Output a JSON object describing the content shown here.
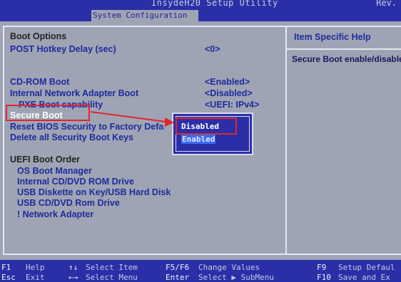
{
  "header": {
    "app_title": "InsydeH20 Setup Utility",
    "rev": "Rev.",
    "active_tab": "System Configuration"
  },
  "settings": {
    "boot_options_heading": "Boot Options",
    "post_delay_label": "POST Hotkey Delay (sec)",
    "post_delay_value": "<0>",
    "cdrom_label": "CD-ROM Boot",
    "cdrom_value": "<Enabled>",
    "nic_label": "Internal Network Adapter Boot",
    "nic_value": "<Disabled>",
    "pxe_label": "PXE Boot capability",
    "pxe_value": "<UEFI: IPv4>",
    "secure_boot_label": "Secure Boot",
    "reset_bios_label": "Reset BIOS Security to Factory Defa",
    "delete_keys_label": "Delete all Security Boot Keys",
    "uefi_heading": "UEFI Boot Order",
    "boot_order": [
      "OS Boot Manager",
      "Internal CD/DVD ROM Drive",
      "USB Diskette on Key/USB Hard Disk",
      "USB CD/DVD Rom Drive",
      "! Network Adapter"
    ]
  },
  "popup": {
    "options": [
      "Disabled",
      "Enabled"
    ],
    "selected": "Enabled"
  },
  "help": {
    "title": "Item Specific Help",
    "text": "Secure Boot enable/disable"
  },
  "footer": {
    "keys": [
      {
        "key": "F1",
        "desc": "Help"
      },
      {
        "key": "Esc",
        "desc": "Exit"
      },
      {
        "key": "↑↓",
        "desc": "Select Item"
      },
      {
        "key": "←→",
        "desc": "Select Menu"
      },
      {
        "key": "F5/F6",
        "desc": "Change Values"
      },
      {
        "key": "Enter",
        "desc": "Select ▶ SubMenu"
      },
      {
        "key": "F9",
        "desc": "Setup Defaul"
      },
      {
        "key": "F10",
        "desc": "Save and Ex"
      }
    ]
  },
  "colors": {
    "background": "#9ea4b4",
    "title_bar": "#2a2fa8",
    "label_blue": "#1f2a9c",
    "highlight_red": "#e0262e"
  }
}
